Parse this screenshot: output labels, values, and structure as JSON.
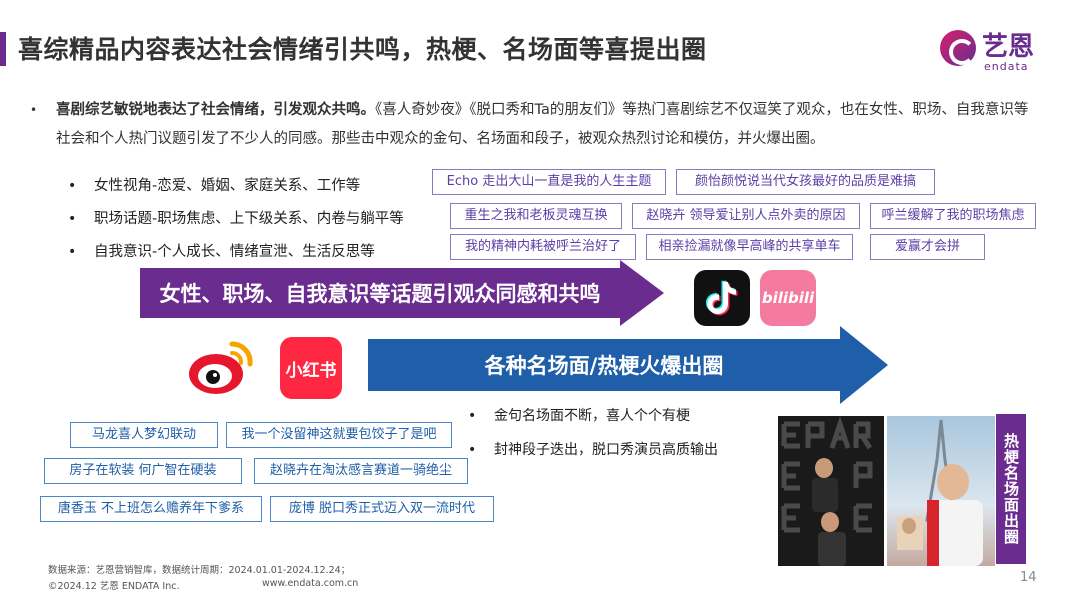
{
  "title": "喜综精品内容表达社会情绪引共鸣，热梗、名场面等喜提出圈",
  "logo": {
    "cn": "艺恩",
    "en": "endata"
  },
  "intro": {
    "bold": "喜剧综艺敏锐地表达了社会情绪，引发观众共鸣。",
    "rest": "《喜人奇妙夜》《脱口秀和Ta的朋友们》等热门喜剧综艺不仅逗笑了观众，也在女性、职场、自我意识等社会和个人热门议题引发了不少人的同感。那些击中观众的金句、名场面和段子，被观众热烈讨论和模仿，并火爆出圈。"
  },
  "topics": [
    "女性视角-恋爱、婚姻、家庭关系、工作等",
    "职场话题-职场焦虑、上下级关系、内卷与躺平等",
    "自我意识-个人成长、情绪宣泄、生活反思等"
  ],
  "purple_tags": [
    "Echo 走出大山一直是我的人生主题",
    "颜怡颜悦说当代女孩最好的品质是难搞",
    "重生之我和老板灵魂互换",
    "赵晓卉 领导爱让别人点外卖的原因",
    "呼兰缓解了我的职场焦虑",
    "我的精神内耗被呼兰治好了",
    "相亲捡漏就像早高峰的共享单车",
    "爱赢才会拼"
  ],
  "arrow1_text": "女性、职场、自我意识等话题引观众同感和共鸣",
  "arrow2_text": "各种名场面/热梗火爆出圈",
  "apps": {
    "bilibili": "bilibili",
    "xiaohongshu": "小红书"
  },
  "blue_tags": [
    "马龙喜人梦幻联动",
    "我一个没留神这就要包饺子了是吧",
    "房子在软装 何广智在硬装",
    "赵晓卉在淘汰感言赛道一骑绝尘",
    "唐香玉 不上班怎么赡养年下爹系",
    "庞博 脱口秀正式迈入双一流时代"
  ],
  "highlights": [
    "金句名场面不断，喜人个个有梗",
    "封神段子迭出，脱口秀演员高质输出"
  ],
  "side_label": "热梗名场面出圈",
  "footer": {
    "source": "数据来源：艺恩营销智库，数据统计周期：2024.01.01-2024.12.24；",
    "copyright": "©2024.12 艺恩 ENDATA Inc.",
    "website": "www.endata.com.cn"
  },
  "page_number": "14",
  "colors": {
    "purple": "#6a2c8f",
    "blue": "#1f5ea8"
  }
}
